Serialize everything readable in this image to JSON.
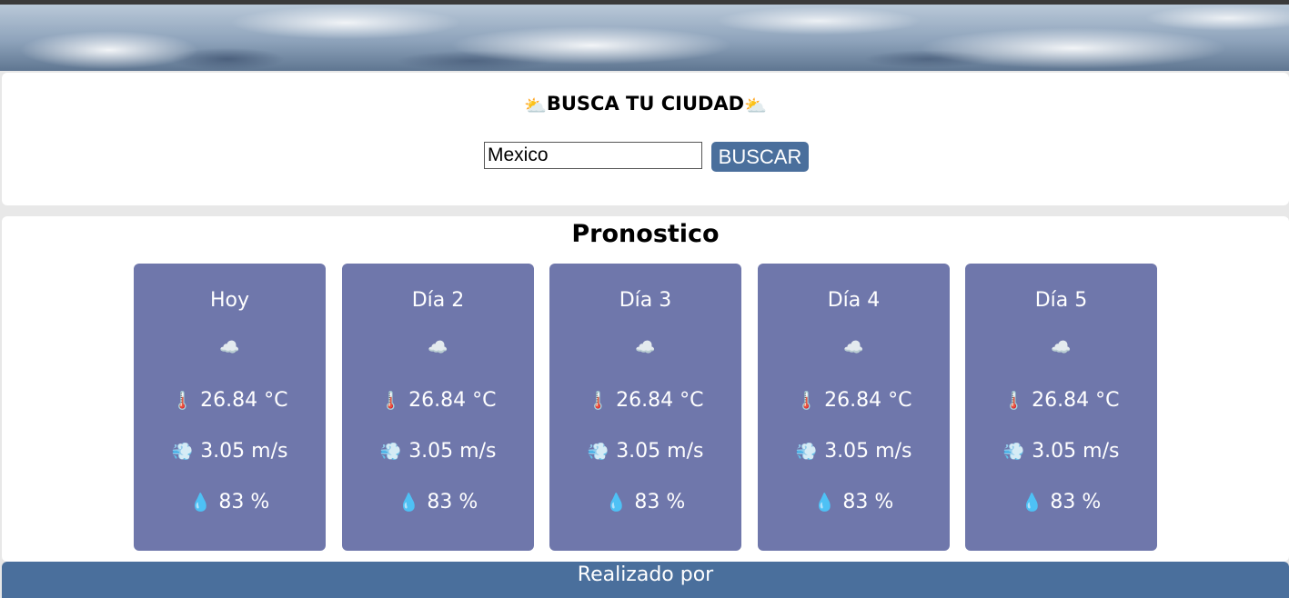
{
  "search": {
    "title": "BUSCA TU CIUDAD",
    "title_icon": "sun-behind-cloud-icon",
    "input_value": "Mexico",
    "button_label": "BUSCAR"
  },
  "forecast": {
    "title": "Pronostico",
    "days": [
      {
        "label": "Hoy",
        "condition_icon": "cloud-icon",
        "temperature": "26.84 °C",
        "wind": "3.05 m/s",
        "humidity": "83 %"
      },
      {
        "label": "Día 2",
        "condition_icon": "cloud-icon",
        "temperature": "26.84 °C",
        "wind": "3.05 m/s",
        "humidity": "83 %"
      },
      {
        "label": "Día 3",
        "condition_icon": "cloud-icon",
        "temperature": "26.84 °C",
        "wind": "3.05 m/s",
        "humidity": "83 %"
      },
      {
        "label": "Día 4",
        "condition_icon": "cloud-icon",
        "temperature": "26.84 °C",
        "wind": "3.05 m/s",
        "humidity": "83 %"
      },
      {
        "label": "Día 5",
        "condition_icon": "cloud-icon",
        "temperature": "26.84 °C",
        "wind": "3.05 m/s",
        "humidity": "83 %"
      }
    ]
  },
  "footer": {
    "text": "Realizado por"
  },
  "colors": {
    "card_background": "#6f77ab",
    "button_background": "#4a6f9c",
    "footer_background": "#4a6f9c"
  }
}
